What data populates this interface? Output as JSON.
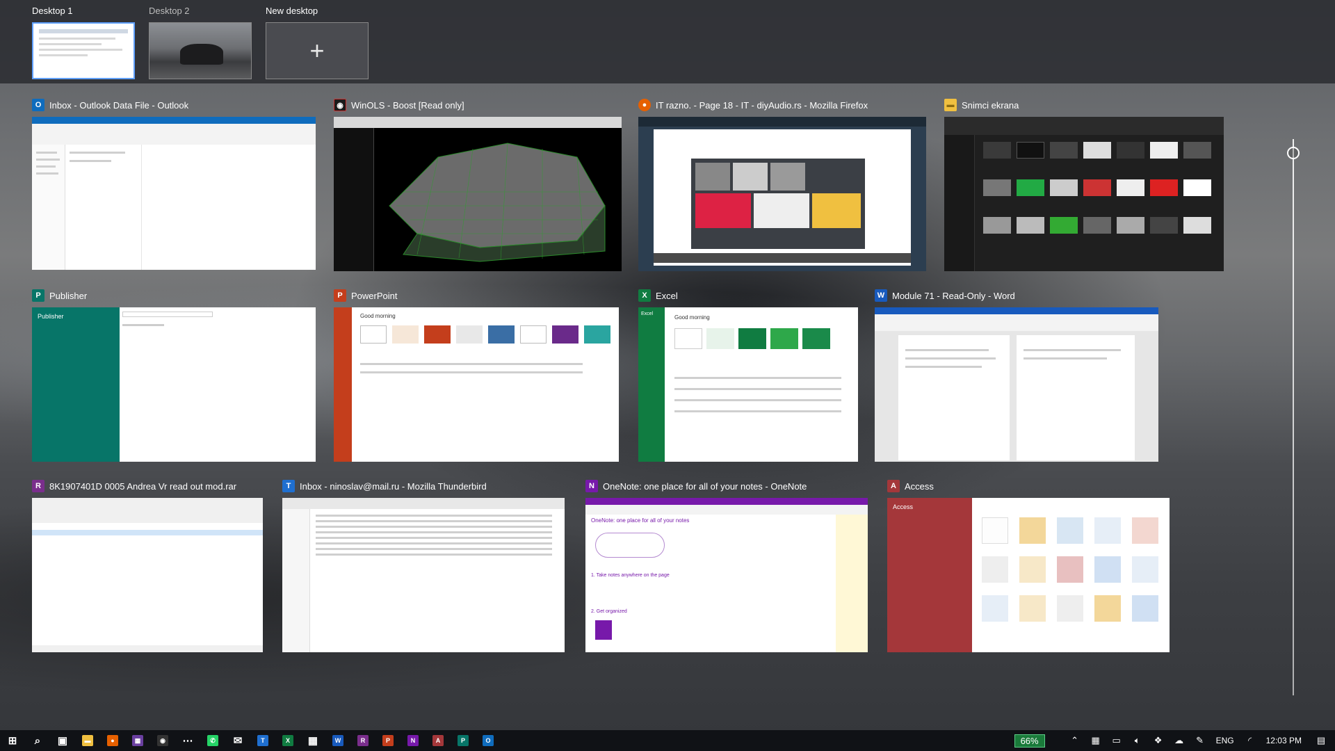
{
  "desktops": [
    {
      "label": "Desktop 1"
    },
    {
      "label": "Desktop 2"
    },
    {
      "label": "New desktop",
      "icon": "plus-icon"
    }
  ],
  "windows": {
    "outlook": {
      "title": "Inbox - Outlook Data File - Outlook",
      "icon": "outlook-icon",
      "color": "#0f6cbd",
      "glyph": "O"
    },
    "winols": {
      "title": "WinOLS - Boost   [Read only]",
      "icon": "winols-icon",
      "color": "#1a1a1a",
      "glyph": "◉"
    },
    "firefox": {
      "title": "IT razno. - Page 18 - IT - diyAudio.rs - Mozilla Firefox",
      "icon": "firefox-icon",
      "color": "#e66000",
      "glyph": "●"
    },
    "explorer": {
      "title": "Snimci ekrana",
      "icon": "folder-icon",
      "color": "#f0c040",
      "glyph": "▬"
    },
    "publisher": {
      "title": "Publisher",
      "icon": "publisher-icon",
      "color": "#077568",
      "glyph": "P"
    },
    "powerpoint": {
      "title": "PowerPoint",
      "icon": "powerpoint-icon",
      "color": "#c43e1c",
      "glyph": "P"
    },
    "excel": {
      "title": "Excel",
      "icon": "excel-icon",
      "color": "#107c41",
      "glyph": "X"
    },
    "word": {
      "title": "Module 71  -  Read-Only  -  Word",
      "icon": "word-icon",
      "color": "#185abd",
      "glyph": "W"
    },
    "winrar": {
      "title": "8K1907401D 0005 Andrea Vr read out mod.rar",
      "icon": "winrar-icon",
      "color": "#7a2e8c",
      "glyph": "R"
    },
    "thunderbird": {
      "title": "Inbox - ninoslav@mail.ru - Mozilla Thunderbird",
      "icon": "thunderbird-icon",
      "color": "#1f6fd0",
      "glyph": "T"
    },
    "onenote": {
      "title": "OneNote: one place for all of your notes - OneNote",
      "icon": "onenote-icon",
      "color": "#7719aa",
      "glyph": "N"
    },
    "access": {
      "title": "Access",
      "icon": "access-icon",
      "color": "#a4373a",
      "glyph": "A"
    }
  },
  "previews": {
    "publisher_app": "Publisher",
    "powerpoint_greeting": "Good morning",
    "excel_greeting": "Good morning",
    "excel_app": "Excel",
    "onenote_heading": "OneNote: one place for all of your notes",
    "onenote_step1": "1. Take notes anywhere on the page",
    "onenote_step2": "2. Get organized",
    "access_app": "Access"
  },
  "taskbar": {
    "items": [
      {
        "name": "start-button",
        "glyph": "⊞",
        "color": ""
      },
      {
        "name": "search-icon",
        "glyph": "⌕",
        "color": ""
      },
      {
        "name": "task-view-icon",
        "glyph": "▣",
        "color": ""
      },
      {
        "name": "file-explorer-icon",
        "glyph": "▬",
        "color": "#f0c040"
      },
      {
        "name": "firefox-icon",
        "glyph": "●",
        "color": "#e66000"
      },
      {
        "name": "winols-tool-icon",
        "glyph": "▦",
        "color": "#6a3fa0"
      },
      {
        "name": "winols-icon",
        "glyph": "◉",
        "color": "#333333"
      },
      {
        "name": "dots-icon",
        "glyph": "⋯",
        "color": ""
      },
      {
        "name": "whatsapp-icon",
        "glyph": "✆",
        "color": "#25d366"
      },
      {
        "name": "mail-icon",
        "glyph": "✉",
        "color": ""
      },
      {
        "name": "thunderbird-icon",
        "glyph": "T",
        "color": "#1f6fd0"
      },
      {
        "name": "excel-icon",
        "glyph": "X",
        "color": "#107c41"
      },
      {
        "name": "calendar-icon",
        "glyph": "▦",
        "color": ""
      },
      {
        "name": "word-icon",
        "glyph": "W",
        "color": "#185abd"
      },
      {
        "name": "winrar-icon",
        "glyph": "R",
        "color": "#7a2e8c"
      },
      {
        "name": "powerpoint-icon",
        "glyph": "P",
        "color": "#c43e1c"
      },
      {
        "name": "onenote-icon",
        "glyph": "N",
        "color": "#7719aa"
      },
      {
        "name": "access-icon",
        "glyph": "A",
        "color": "#a4373a"
      },
      {
        "name": "publisher-icon",
        "glyph": "P",
        "color": "#077568"
      },
      {
        "name": "outlook-icon",
        "glyph": "O",
        "color": "#0f6cbd"
      }
    ],
    "battery": "66%",
    "language": "ENG",
    "clock": "12:03 PM"
  }
}
